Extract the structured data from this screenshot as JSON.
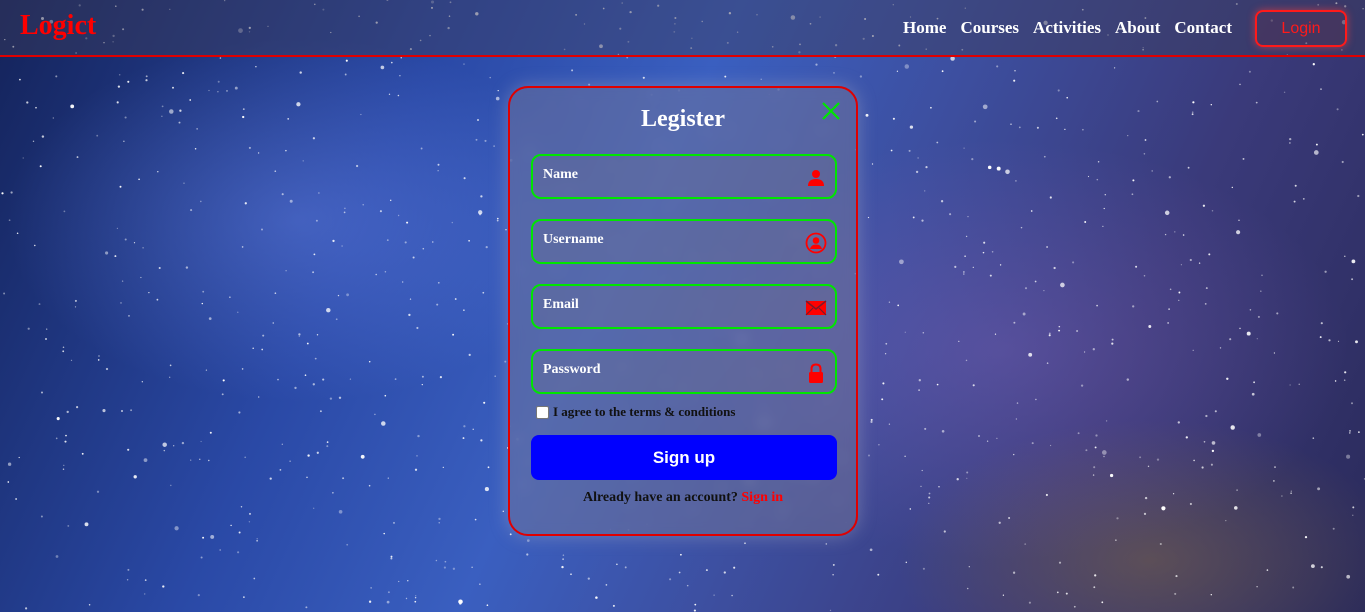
{
  "header": {
    "logo": "Logict",
    "nav": [
      "Home",
      "Courses",
      "Activities",
      "About",
      "Contact"
    ],
    "login_label": "Login"
  },
  "modal": {
    "title": "Legister",
    "fields": [
      {
        "placeholder": "Name",
        "icon": "person-icon"
      },
      {
        "placeholder": "Username",
        "icon": "user-circle-icon"
      },
      {
        "placeholder": "Email",
        "icon": "mail-icon"
      },
      {
        "placeholder": "Password",
        "icon": "lock-icon"
      }
    ],
    "terms_label": "I agree to the terms & conditions",
    "signup_label": "Sign up",
    "already_text": "Already have an account?",
    "signin_label": "Sign in"
  },
  "colors": {
    "accent_red": "#ff0000",
    "field_border": "#00e600",
    "button_blue": "#0000ff"
  }
}
